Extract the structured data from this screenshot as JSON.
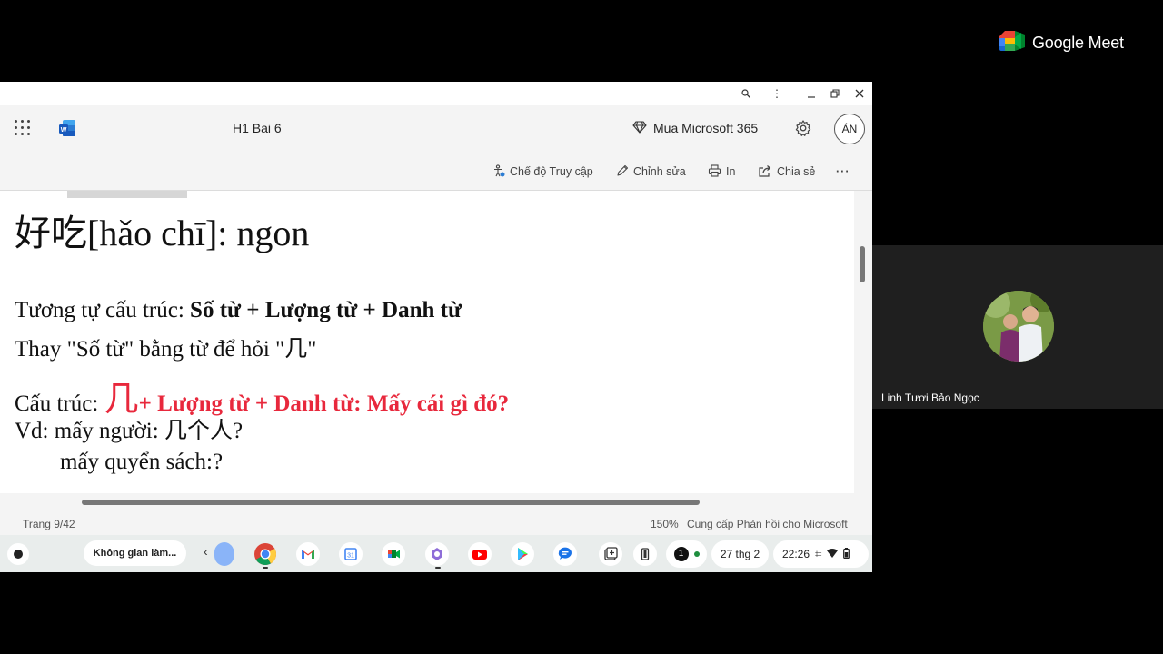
{
  "meet": {
    "brand": "Google Meet"
  },
  "participant": {
    "name": "Linh Tươi Bảo Ngọc"
  },
  "window": {
    "buttons": [
      "zoom",
      "more",
      "minimize",
      "restore",
      "close"
    ]
  },
  "word": {
    "doc_title": "H1 Bai 6",
    "buy_label": "Mua Microsoft 365",
    "account_initials": "ÁN"
  },
  "ribbon": {
    "access_mode": "Chế độ Truy cập",
    "edit": "Chỉnh sửa",
    "print": "In",
    "share": "Chia sẻ",
    "more": "···"
  },
  "document": {
    "line1": "好吃[hǎo chī]: ngon",
    "line2_plain": "Tương tự cấu trúc: ",
    "line2_bold": "Số từ + Lượng từ + Danh từ",
    "line3": "Thay \"Số từ\" bằng từ để hỏi \"几\"",
    "line4_label": "Cấu trúc: ",
    "line4_char": "几",
    "line4_rest": "+ Lượng từ + Danh từ: Mấy cái gì đó?",
    "line5": "Vd: mấy người: 几个人?",
    "line6": "mấy quyển sách:?"
  },
  "status": {
    "page": "Trang 9/42",
    "zoom": "150%",
    "feedback": "Cung cấp Phản hồi cho Microsoft"
  },
  "shelf": {
    "desk": "Không gian làm...",
    "notification_count": "1",
    "date": "27 thg 2",
    "time": "22:26"
  },
  "colors": {
    "accent_red": "#e8283c",
    "word_blue": "#185abd",
    "background": "#000000"
  }
}
